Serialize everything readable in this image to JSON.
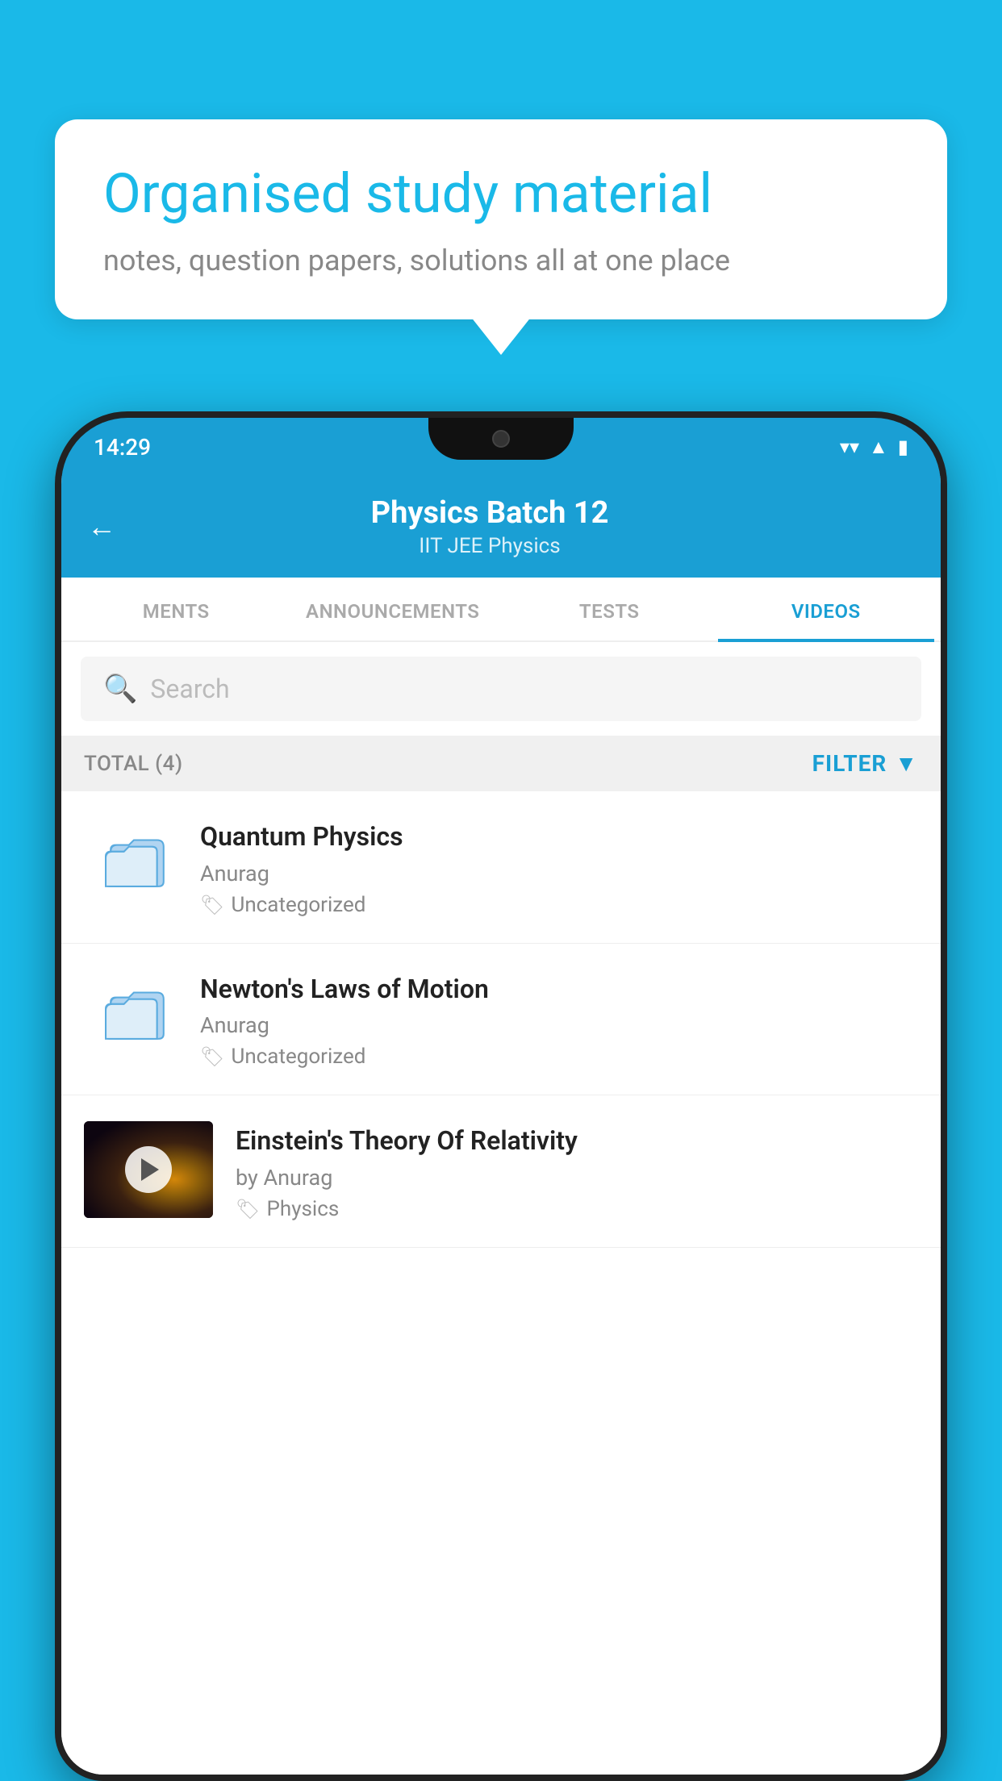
{
  "background_color": "#1ab9e8",
  "bubble": {
    "title": "Organised study material",
    "subtitle": "notes, question papers, solutions all at one place"
  },
  "status_bar": {
    "time": "14:29",
    "wifi_icon": "▼",
    "signal_icon": "◀",
    "battery_icon": "▮"
  },
  "app_header": {
    "back_label": "←",
    "title": "Physics Batch 12",
    "subtitle_part1": "IIT JEE",
    "subtitle_separator": "   ",
    "subtitle_part2": "Physics"
  },
  "tabs": [
    {
      "label": "MENTS",
      "active": false
    },
    {
      "label": "ANNOUNCEMENTS",
      "active": false
    },
    {
      "label": "TESTS",
      "active": false
    },
    {
      "label": "VIDEOS",
      "active": true
    }
  ],
  "search": {
    "placeholder": "Search"
  },
  "filter_bar": {
    "total_label": "TOTAL (4)",
    "filter_label": "FILTER"
  },
  "videos": [
    {
      "id": 1,
      "title": "Quantum Physics",
      "author": "Anurag",
      "tag": "Uncategorized",
      "type": "folder",
      "has_thumbnail": false
    },
    {
      "id": 2,
      "title": "Newton's Laws of Motion",
      "author": "Anurag",
      "tag": "Uncategorized",
      "type": "folder",
      "has_thumbnail": false
    },
    {
      "id": 3,
      "title": "Einstein's Theory Of Relativity",
      "author": "by Anurag",
      "tag": "Physics",
      "type": "video",
      "has_thumbnail": true
    }
  ]
}
